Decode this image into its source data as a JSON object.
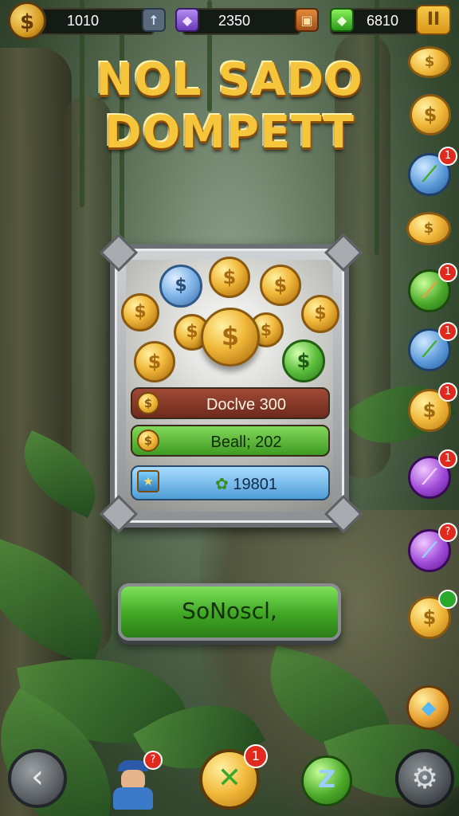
{
  "topbar": {
    "coins": "1010",
    "gems": "2350",
    "emeralds": "6810",
    "icons": [
      "dollar-coin-icon",
      "arrow-up-icon",
      "purple-gem-icon",
      "treasure-chest-icon",
      "green-gem-icon",
      "pause-icon"
    ]
  },
  "title": {
    "line1": "NOL SADO",
    "line2": "DOMPETT"
  },
  "panel": {
    "rows": [
      {
        "text": "Doclve 300"
      },
      {
        "text": "Beall; 202"
      },
      {
        "text": "19801"
      }
    ]
  },
  "cta": {
    "label": "SoNoscl,"
  },
  "side_rail": {
    "badges": [
      "1",
      "1",
      "1",
      "1",
      "1",
      "?"
    ]
  },
  "bottom_nav": {
    "badges": [
      "1"
    ]
  },
  "colors": {
    "title_gold": "#f5c53c",
    "bar_red": "#8a3a2a",
    "bar_green": "#4fb22c",
    "bar_blue": "#6fb6e8",
    "cta_green": "#4fbf2c"
  }
}
